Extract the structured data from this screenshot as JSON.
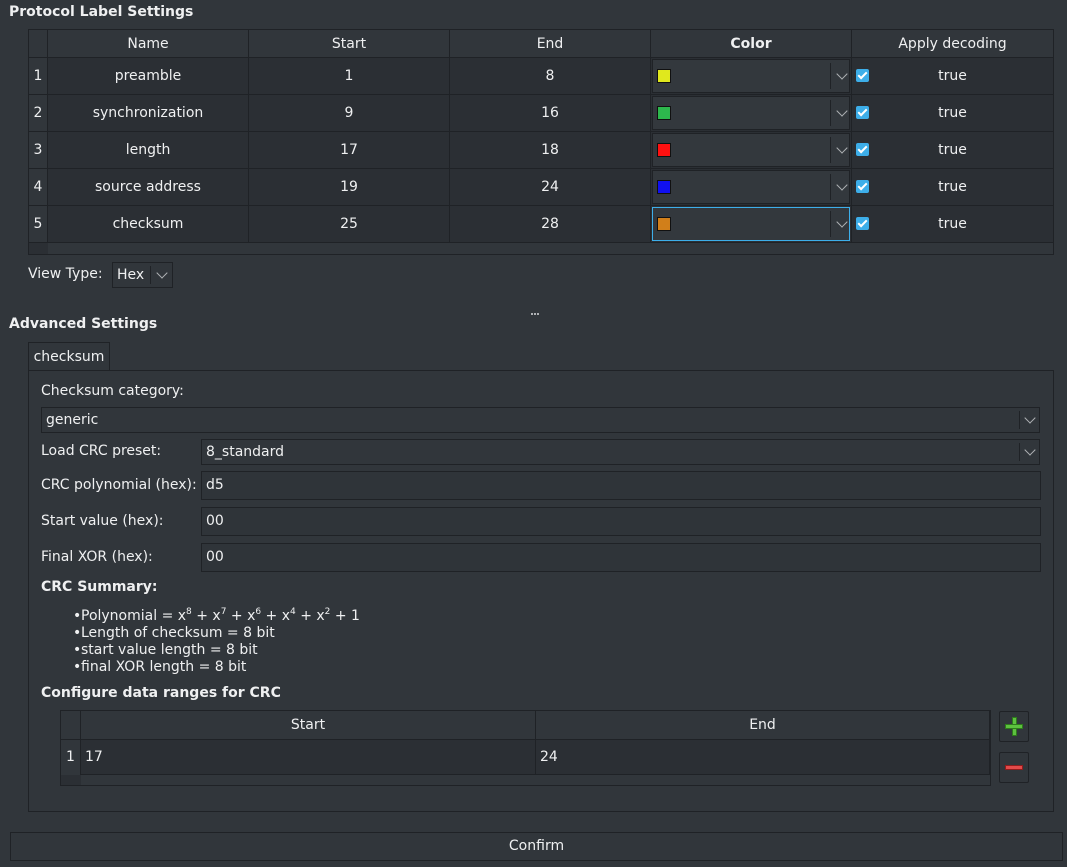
{
  "protocol_label": {
    "title": "Protocol Label Settings",
    "columns": [
      "Name",
      "Start",
      "End",
      "Color",
      "Apply decoding"
    ],
    "rows": [
      {
        "num": "1",
        "name": "preamble",
        "start": "1",
        "end": "8",
        "color": "#e0e81d",
        "decoding": "true"
      },
      {
        "num": "2",
        "name": "synchronization",
        "start": "9",
        "end": "16",
        "color": "#2db84d",
        "decoding": "true"
      },
      {
        "num": "3",
        "name": "length",
        "start": "17",
        "end": "18",
        "color": "#ff1010",
        "decoding": "true"
      },
      {
        "num": "4",
        "name": "source address",
        "start": "19",
        "end": "24",
        "color": "#1010f0",
        "decoding": "true"
      },
      {
        "num": "5",
        "name": "checksum",
        "start": "25",
        "end": "28",
        "color": "#d17f1a",
        "decoding": "true"
      }
    ]
  },
  "view_type": {
    "label": "View Type:",
    "value": "Hex"
  },
  "advanced": {
    "title": "Advanced Settings",
    "tab": "checksum",
    "checksum_category_label": "Checksum category:",
    "checksum_category_value": "generic",
    "crc_preset_label": "Load CRC preset:",
    "crc_preset_value": "8_standard",
    "crc_poly_label": "CRC polynomial (hex):",
    "crc_poly_value": "d5",
    "start_value_label": "Start value (hex):",
    "start_value_value": "00",
    "final_xor_label": "Final XOR (hex):",
    "final_xor_value": "00",
    "summary_title": "CRC Summary:",
    "summary_items": [
      "Length of checksum = 8 bit",
      "start value length = 8 bit",
      "final XOR length = 8 bit"
    ],
    "polynomial_prefix": "Polynomial = ",
    "ranges_title": "Configure data ranges for CRC",
    "ranges_columns": [
      "Start",
      "End"
    ],
    "ranges_rows": [
      {
        "num": "1",
        "start": "17",
        "end": "24"
      }
    ]
  },
  "confirm_label": "Confirm",
  "icons": {
    "add": "plus-icon",
    "remove": "minus-icon"
  }
}
